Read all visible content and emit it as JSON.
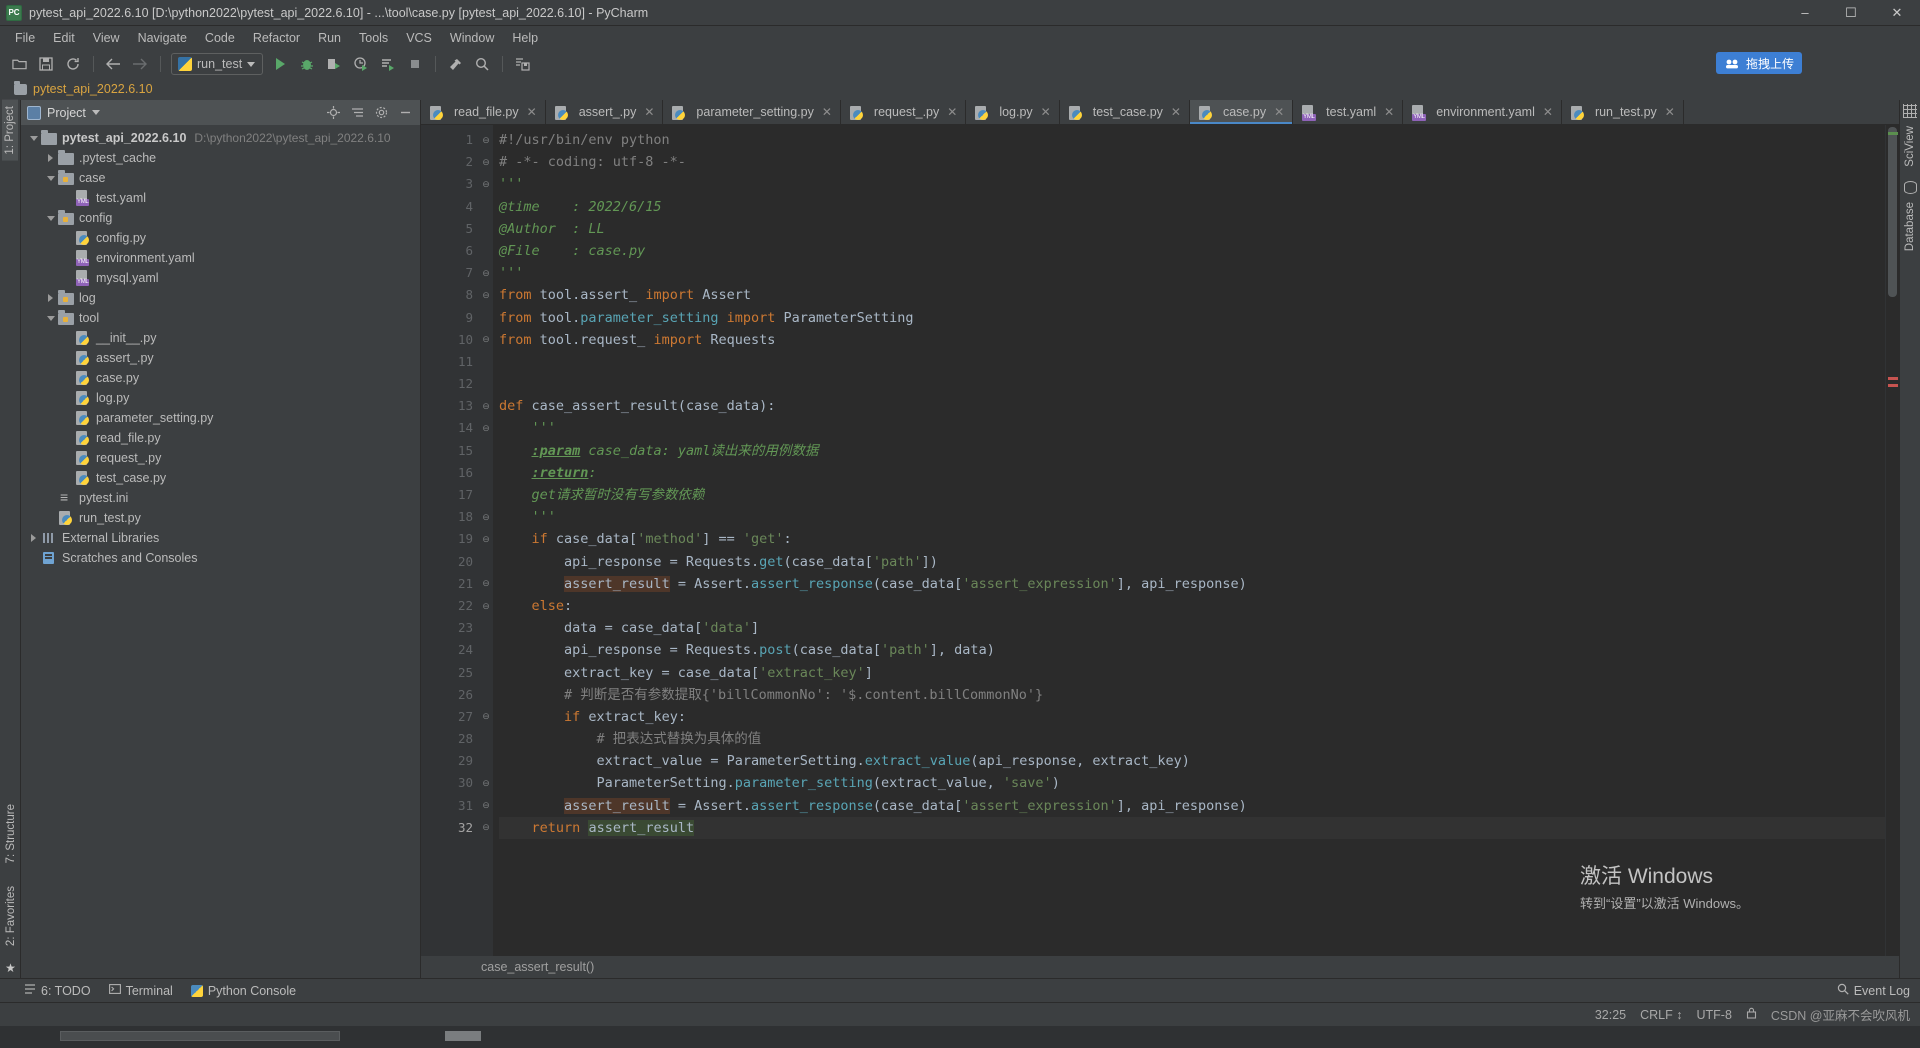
{
  "window": {
    "title": "pytest_api_2022.6.10 [D:\\python2022\\pytest_api_2022.6.10] - ...\\tool\\case.py [pytest_api_2022.6.10] - PyCharm",
    "app_badge": "PC",
    "minimize": "–",
    "maximize": "☐",
    "close": "✕"
  },
  "menu": [
    "File",
    "Edit",
    "View",
    "Navigate",
    "Code",
    "Refactor",
    "Run",
    "Tools",
    "VCS",
    "Window",
    "Help"
  ],
  "toolbar": {
    "run_config": "run_test",
    "buttons": [
      "open-icon",
      "save-all-icon",
      "sync-icon",
      "back-icon",
      "forward-icon",
      "run-icon",
      "debug-icon",
      "run-coverage-icon",
      "profile-icon",
      "run-with-options-icon",
      "stop-icon",
      "settings-icon",
      "search-everywhere-icon",
      "update-project-icon"
    ],
    "upload_label": "拖拽上传"
  },
  "navbar": {
    "crumb": "pytest_api_2022.6.10"
  },
  "left_strip": {
    "project_tab": "1: Project",
    "structure_tab": "7: Structure",
    "favorites_tab": "2: Favorites"
  },
  "right_strip": {
    "sci_view": "SciView",
    "database": "Database"
  },
  "project_panel": {
    "header": "Project",
    "tree": [
      {
        "indent": 0,
        "arrow": "down",
        "icon": "dir",
        "label": "pytest_api_2022.6.10",
        "bold": true,
        "path": "D:\\python2022\\pytest_api_2022.6.10"
      },
      {
        "indent": 1,
        "arrow": "right",
        "icon": "dir",
        "label": ".pytest_cache"
      },
      {
        "indent": 1,
        "arrow": "down",
        "icon": "dirsrc",
        "label": "case"
      },
      {
        "indent": 2,
        "arrow": "none",
        "icon": "yml",
        "label": "test.yaml"
      },
      {
        "indent": 1,
        "arrow": "down",
        "icon": "dirsrc",
        "label": "config"
      },
      {
        "indent": 2,
        "arrow": "none",
        "icon": "py",
        "label": "config.py"
      },
      {
        "indent": 2,
        "arrow": "none",
        "icon": "yml",
        "label": "environment.yaml"
      },
      {
        "indent": 2,
        "arrow": "none",
        "icon": "yml",
        "label": "mysql.yaml"
      },
      {
        "indent": 1,
        "arrow": "right",
        "icon": "dirsrc",
        "label": "log"
      },
      {
        "indent": 1,
        "arrow": "down",
        "icon": "dirsrc",
        "label": "tool"
      },
      {
        "indent": 2,
        "arrow": "none",
        "icon": "py",
        "label": "__init__.py"
      },
      {
        "indent": 2,
        "arrow": "none",
        "icon": "py",
        "label": "assert_.py"
      },
      {
        "indent": 2,
        "arrow": "none",
        "icon": "py",
        "label": "case.py"
      },
      {
        "indent": 2,
        "arrow": "none",
        "icon": "py",
        "label": "log.py"
      },
      {
        "indent": 2,
        "arrow": "none",
        "icon": "py",
        "label": "parameter_setting.py"
      },
      {
        "indent": 2,
        "arrow": "none",
        "icon": "py",
        "label": "read_file.py"
      },
      {
        "indent": 2,
        "arrow": "none",
        "icon": "py",
        "label": "request_.py"
      },
      {
        "indent": 2,
        "arrow": "none",
        "icon": "py",
        "label": "test_case.py"
      },
      {
        "indent": 1,
        "arrow": "none",
        "icon": "ini",
        "label": "pytest.ini"
      },
      {
        "indent": 1,
        "arrow": "none",
        "icon": "py",
        "label": "run_test.py"
      },
      {
        "indent": 0,
        "arrow": "right",
        "icon": "lib",
        "label": "External Libraries"
      },
      {
        "indent": 0,
        "arrow": "none",
        "icon": "scratch",
        "label": "Scratches and Consoles"
      }
    ]
  },
  "editor_tabs": [
    {
      "label": "read_file.py",
      "icon": "py",
      "active": false
    },
    {
      "label": "assert_.py",
      "icon": "py",
      "active": false
    },
    {
      "label": "parameter_setting.py",
      "icon": "py",
      "active": false
    },
    {
      "label": "request_.py",
      "icon": "py",
      "active": false
    },
    {
      "label": "log.py",
      "icon": "py",
      "active": false
    },
    {
      "label": "test_case.py",
      "icon": "py",
      "active": false
    },
    {
      "label": "case.py",
      "icon": "py",
      "active": true
    },
    {
      "label": "test.yaml",
      "icon": "yml",
      "active": false
    },
    {
      "label": "environment.yaml",
      "icon": "yml",
      "active": false
    },
    {
      "label": "run_test.py",
      "icon": "py",
      "active": false
    }
  ],
  "editor": {
    "filename": "case.py",
    "first_line": 1,
    "last_line": 32,
    "breadcrumb": "case_assert_result()",
    "lines": [
      "#!/usr/bin/env python",
      "# -*- coding: utf-8 -*-",
      "'''",
      "@time    : 2022/6/15",
      "@Author  : LL",
      "@File    : case.py",
      "'''",
      "from tool.assert_ import Assert",
      "from tool.parameter_setting import ParameterSetting",
      "from tool.request_ import Requests",
      "",
      "",
      "def case_assert_result(case_data):",
      "    '''",
      "    :param case_data: yaml读出来的用例数据",
      "    :return:",
      "    get请求暂时没有写参数依赖",
      "    '''",
      "    if case_data['method'] == 'get':",
      "        api_response = Requests.get(case_data['path'])",
      "        assert_result = Assert.assert_response(case_data['assert_expression'], api_response)",
      "    else:",
      "        data = case_data['data']",
      "        api_response = Requests.post(case_data['path'], data)",
      "        extract_key = case_data['extract_key']",
      "        # 判断是否有参数提取{'billCommonNo': '$.content.billCommonNo'}",
      "        if extract_key:",
      "            # 把表达式替换为具体的值",
      "            extract_value = ParameterSetting.extract_value(api_response, extract_key)",
      "            ParameterSetting.parameter_setting(extract_value, 'save')",
      "        assert_result = Assert.assert_response(case_data['assert_expression'], api_response)",
      "    return assert_result"
    ]
  },
  "bottom_bar": {
    "todo": "6: TODO",
    "terminal": "Terminal",
    "python_console": "Python Console",
    "event_log": "Event Log"
  },
  "status_bar": {
    "position": "32:25",
    "line_separator": "CRLF",
    "encoding": "UTF-8",
    "csdn": "CSDN @亚麻不会吹风机"
  },
  "watermark": {
    "line1": "激活 Windows",
    "line2": "转到“设置”以激活 Windows。"
  },
  "colors": {
    "accent": "#4a88c7",
    "keyword": "#cc7832",
    "string": "#6a8759",
    "comment": "#808080",
    "doc": "#629755",
    "method": "#59a5b5",
    "function": "#ffc66d",
    "editor_bg": "#2b2b2b",
    "panel_bg": "#3c3f41"
  }
}
